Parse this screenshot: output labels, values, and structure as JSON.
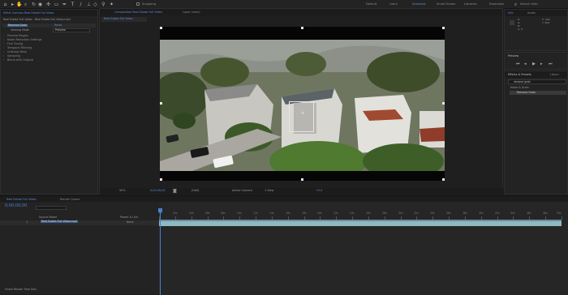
{
  "toolbar": {
    "snapping_label": "Snapping",
    "workspaces": [
      "Default",
      "Learn",
      "Standard",
      "Small Screen",
      "Libraries",
      "Essentials"
    ],
    "search_label": "Search Help"
  },
  "project_panel": {
    "tab_label": "Effect Controls Real Estate Full Video",
    "layer_path": "Real Estate Full Video - Real Estate Full Video.mp4",
    "effect_name": "Remove Grain",
    "reset_label": "Reset",
    "viewing_mode_label": "Viewing Mode",
    "viewing_mode_value": "Preview",
    "properties": [
      "Preview Region",
      "Noise Reduction Settings",
      "Fine Tuning",
      "Temporal Filtering",
      "Unsharp Mask",
      "Sampling",
      "Blend with Original"
    ]
  },
  "composition_panel": {
    "tab_label": "Composition Real Estate Full Video",
    "layer_tab": "Layer (none)",
    "sub_tab": "Real Estate Full Video",
    "bottom_bar": {
      "zoom": "50%",
      "timecode": "0;00;00;00",
      "resolution": "(Half)",
      "camera": "Active Camera",
      "views": "1 View",
      "exposure": "+0.0"
    }
  },
  "info_panel": {
    "tabs": [
      "Info",
      "Audio"
    ],
    "values": [
      "R:",
      "G:",
      "B:",
      "A: 0"
    ],
    "coords": [
      "X: 400",
      "Y: 506"
    ]
  },
  "preview_panel": {
    "label": "Preview"
  },
  "effects_panel": {
    "tab_label": "Effects & Presets",
    "lib_label": "Librari",
    "search_value": "remove grain",
    "category": "Noise & Grain",
    "result": "Remove Grain"
  },
  "timeline": {
    "tab_label": "Real Estate Full Video",
    "render_queue_label": "Render Queue",
    "timecode": "0;00;00;00",
    "col_source": "Source Name",
    "col_parent": "Parent & Link",
    "layer_number": "1",
    "layer_name": "Real Estate Full Video.mp4",
    "layer_parent": "None",
    "ruler": [
      "0f",
      "02s",
      "04s",
      "06s",
      "08s",
      "10s",
      "12s",
      "14s",
      "16s",
      "18s",
      "20s",
      "22s",
      "24s",
      "26s",
      "28s",
      "30s",
      "32s",
      "34s",
      "36s",
      "38s",
      "40s",
      "42s",
      "44s",
      "46s",
      "48s",
      "50s"
    ],
    "bottom_label": "Frame Render Time 0ms"
  },
  "colors": {
    "accent": "#4a7fcf",
    "layer_bar": "#8fb9bd",
    "work_area": "#6a8caa"
  },
  "icons": [
    "selection-tool-icon",
    "hand-tool-icon",
    "zoom-tool-icon",
    "rotate-tool-icon",
    "camera-tool-icon",
    "pan-behind-icon",
    "mask-tool-icon",
    "pen-tool-icon",
    "type-tool-icon",
    "brush-tool-icon",
    "clone-stamp-icon",
    "eraser-icon",
    "roto-brush-icon",
    "puppet-pin-icon",
    "search-icon",
    "play-icon"
  ]
}
